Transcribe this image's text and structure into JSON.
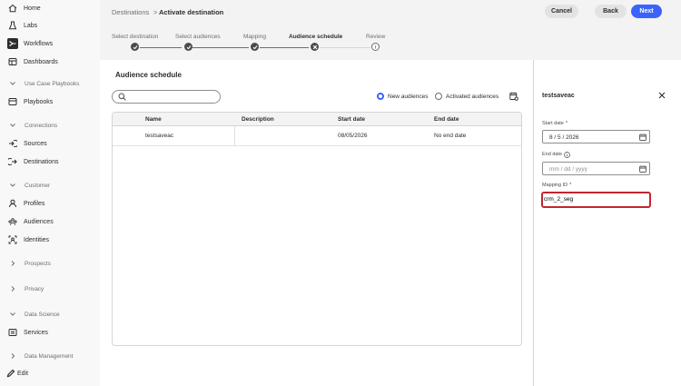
{
  "sidebar": {
    "items": [
      {
        "label": "Home",
        "icon": "home-icon"
      },
      {
        "label": "Labs",
        "icon": "labs-icon"
      },
      {
        "label": "Workflows",
        "icon": "workflows-icon"
      },
      {
        "label": "Dashboards",
        "icon": "dashboards-icon"
      },
      {
        "label": "Use Case Playbooks",
        "icon": "chevron-down-icon"
      },
      {
        "label": "Playbooks",
        "icon": "playbooks-icon"
      },
      {
        "label": "Connections",
        "icon": "chevron-down-icon"
      },
      {
        "label": "Sources",
        "icon": "sources-icon"
      },
      {
        "label": "Destinations",
        "icon": "destinations-icon"
      },
      {
        "label": "Customer",
        "icon": "chevron-down-icon"
      },
      {
        "label": "Profiles",
        "icon": "profiles-icon"
      },
      {
        "label": "Audiences",
        "icon": "audiences-icon"
      },
      {
        "label": "Identities",
        "icon": "identities-icon"
      },
      {
        "label": "Prospects",
        "icon": "chevron-right-icon"
      },
      {
        "label": "Privacy",
        "icon": "chevron-right-icon"
      },
      {
        "label": "Data Science",
        "icon": "chevron-down-icon"
      },
      {
        "label": "Services",
        "icon": "services-icon"
      },
      {
        "label": "Data Management",
        "icon": "chevron-right-icon"
      }
    ],
    "edit_label": "Edit"
  },
  "header": {
    "breadcrumb_parent": "Destinations",
    "breadcrumb_sep": ">",
    "breadcrumb_current": "Activate destination",
    "cancel_label": "Cancel",
    "back_label": "Back",
    "next_label": "Next"
  },
  "steps": [
    {
      "label": "Select destination",
      "state": "done"
    },
    {
      "label": "Select audiences",
      "state": "done"
    },
    {
      "label": "Mapping",
      "state": "done"
    },
    {
      "label": "Audience schedule",
      "state": "current"
    },
    {
      "label": "Review",
      "state": "todo"
    }
  ],
  "main": {
    "title": "Audience schedule",
    "search_placeholder": "",
    "radio_new": "New audiences",
    "radio_activated": "Activated audiences",
    "table": {
      "headers": [
        "Name",
        "Description",
        "Start date",
        "End date"
      ],
      "rows": [
        {
          "name": "testsaveac",
          "description": "",
          "start": "08/05/2026",
          "end": "No end date"
        }
      ]
    }
  },
  "details": {
    "title": "testsaveac",
    "start_label": "Start date",
    "start_required": "*",
    "start_value": "8 / 5 / 2026",
    "end_label": "End date",
    "end_placeholder": "mm / dd / yyyy",
    "mapping_label": "Mapping ID",
    "mapping_required": "*",
    "mapping_value": "crm_2_seg"
  },
  "colors": {
    "accent": "#3b63fb",
    "focus_border": "#c2262e"
  }
}
